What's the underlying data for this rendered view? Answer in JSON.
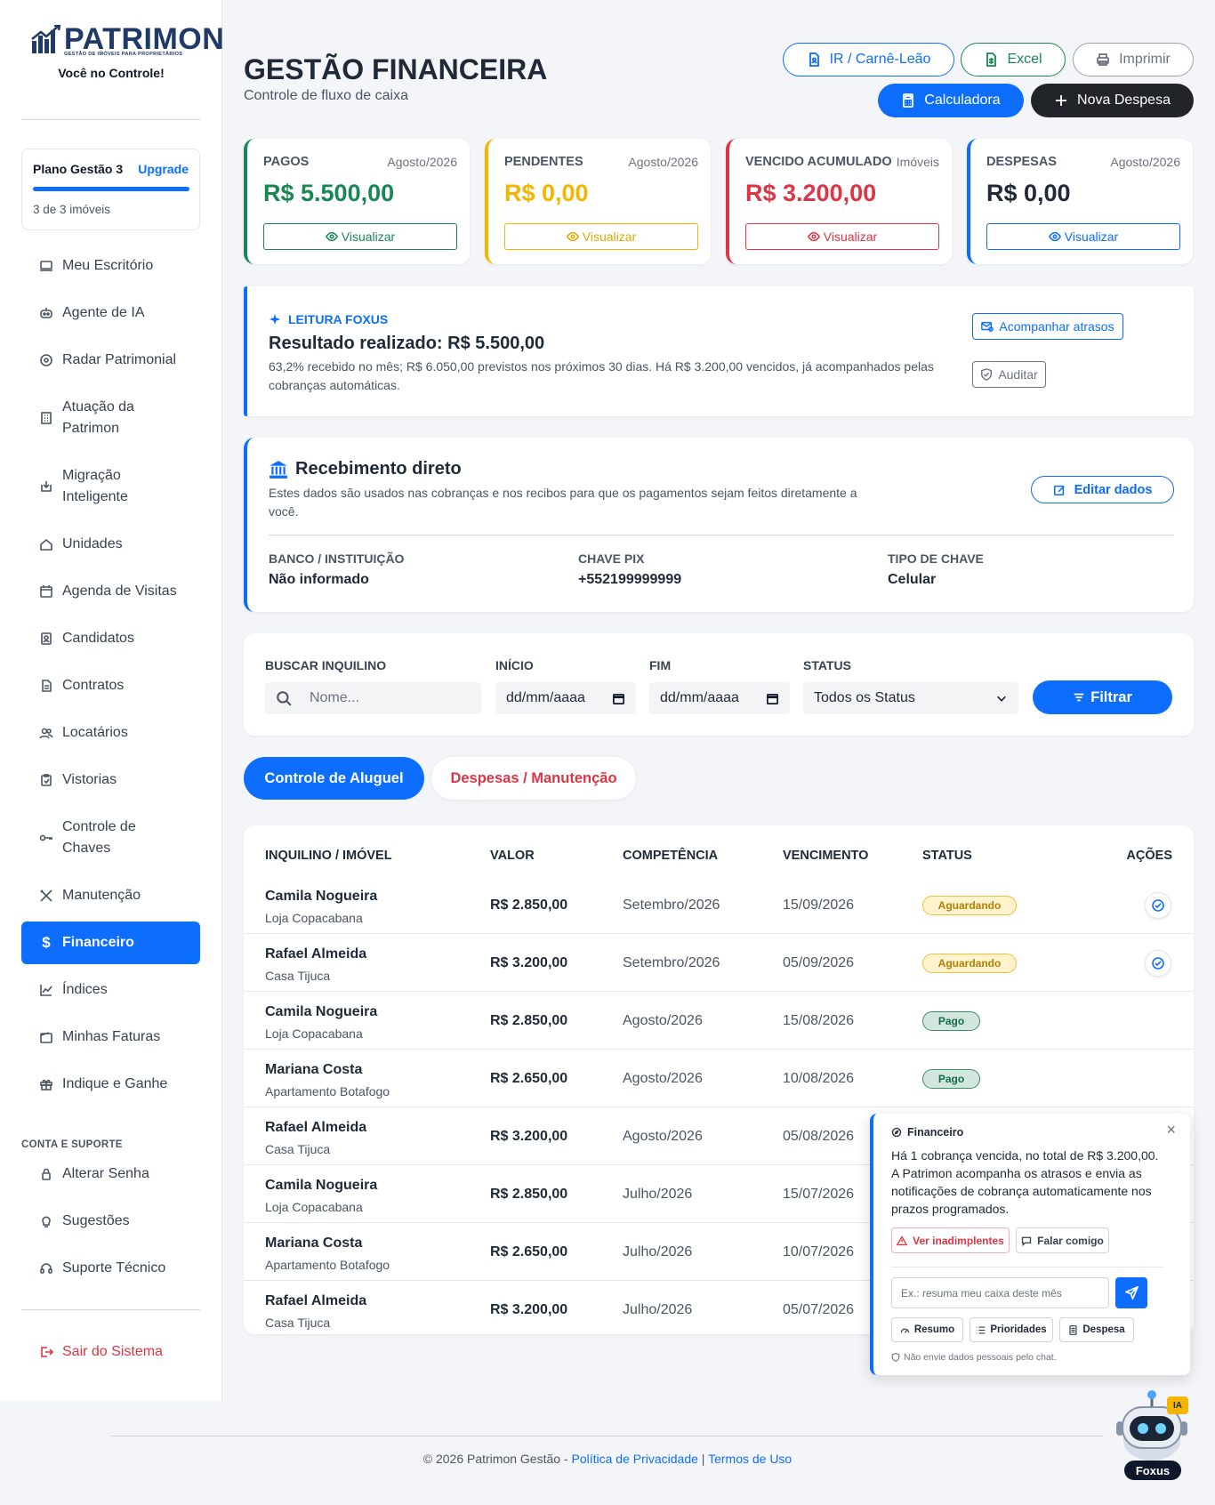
{
  "sidebar": {
    "brand": "PATRIMON",
    "brand_sub": "GESTÃO DE IMÓVEIS PARA PROPRIETÁRIOS",
    "tagline": "Você no Controle!",
    "plan": {
      "name": "Plano Gestão 3",
      "upgrade": "Upgrade",
      "count": "3 de 3 imóveis",
      "usage_fraction": 1.0
    },
    "items": [
      {
        "label": "Meu Escritório",
        "icon": "laptop-icon"
      },
      {
        "label": "Agente de IA",
        "icon": "robot-icon"
      },
      {
        "label": "Radar Patrimonial",
        "icon": "radar-icon"
      },
      {
        "label": "Atuação da Patrimon",
        "icon": "building-icon"
      },
      {
        "label": "Migração Inteligente",
        "icon": "inbox-icon"
      },
      {
        "label": "Unidades",
        "icon": "home-icon"
      },
      {
        "label": "Agenda de Visitas",
        "icon": "calendar-icon"
      },
      {
        "label": "Candidatos",
        "icon": "id-badge-icon"
      },
      {
        "label": "Contratos",
        "icon": "file-icon"
      },
      {
        "label": "Locatários",
        "icon": "people-icon"
      },
      {
        "label": "Vistorias",
        "icon": "clipboard-icon"
      },
      {
        "label": "Controle de Chaves",
        "icon": "key-icon"
      },
      {
        "label": "Manutenção",
        "icon": "tools-icon"
      },
      {
        "label": "Financeiro",
        "icon": "dollar-icon",
        "active": true
      },
      {
        "label": "Índices",
        "icon": "chart-icon"
      },
      {
        "label": "Minhas Faturas",
        "icon": "wallet-icon"
      },
      {
        "label": "Indique e Ganhe",
        "icon": "gift-icon"
      }
    ],
    "support_title": "CONTA E SUPORTE",
    "support_items": [
      {
        "label": "Alterar Senha",
        "icon": "lock-icon"
      },
      {
        "label": "Sugestões",
        "icon": "lightbulb-icon"
      },
      {
        "label": "Suporte Técnico",
        "icon": "headset-icon"
      }
    ],
    "logout": "Sair do Sistema"
  },
  "header": {
    "title": "GESTÃO FINANCEIRA",
    "subtitle": "Controle de fluxo de caixa",
    "buttons": {
      "ir": "IR / Carnê-Leão",
      "excel": "Excel",
      "print": "Imprimir",
      "calc": "Calculadora",
      "new": "Nova Despesa"
    }
  },
  "cards": [
    {
      "title": "PAGOS",
      "period": "Agosto/2026",
      "value": "R$ 5.500,00",
      "action": "Visualizar",
      "color": "#198754"
    },
    {
      "title": "PENDENTES",
      "period": "Agosto/2026",
      "value": "R$ 0,00",
      "action": "Visualizar",
      "color": "#f5b400"
    },
    {
      "title": "VENCIDO ACUMULADO",
      "period": "Imóveis",
      "value": "R$ 3.200,00",
      "action": "Visualizar",
      "color": "#dc3545"
    },
    {
      "title": "DESPESAS",
      "period": "Agosto/2026",
      "value": "R$ 0,00",
      "action": "Visualizar",
      "color": "#0d6efd"
    }
  ],
  "foxus": {
    "tag": "LEITURA FOXUS",
    "title": "Resultado realizado: R$ 5.500,00",
    "text": "63,2% recebido no mês; R$ 6.050,00 previstos nos próximos 30 dias. Há R$ 3.200,00 vencidos, já acompanhados pelas cobranças automáticas.",
    "btn_track": "Acompanhar atrasos",
    "btn_audit": "Auditar"
  },
  "direct": {
    "title": "Recebimento direto",
    "text": "Estes dados são usados nas cobranças e nos recibos para que os pagamentos sejam feitos diretamente a você.",
    "edit": "Editar dados",
    "fields": [
      {
        "k": "BANCO / INSTITUIÇÃO",
        "v": "Não informado"
      },
      {
        "k": "CHAVE PIX",
        "v": "+552199999999"
      },
      {
        "k": "TIPO DE CHAVE",
        "v": "Celular"
      }
    ]
  },
  "filters": {
    "search_label": "BUSCAR INQUILINO",
    "search_placeholder": "Nome...",
    "start_label": "INÍCIO",
    "start_value": "dd/mm/aaaa",
    "end_label": "FIM",
    "end_value": "dd/mm/aaaa",
    "status_label": "STATUS",
    "status_value": "Todos os Status",
    "filter_button": "Filtrar"
  },
  "tabs": {
    "rent": "Controle de Aluguel",
    "expenses": "Despesas / Manutenção"
  },
  "table": {
    "headers": [
      "INQUILINO / IMÓVEL",
      "VALOR",
      "COMPETÊNCIA",
      "VENCIMENTO",
      "STATUS",
      "AÇÕES"
    ],
    "rows": [
      {
        "tenant": "Camila Nogueira",
        "property": "Loja Copacabana",
        "value": "R$ 2.850,00",
        "period": "Setembro/2026",
        "due": "15/09/2026",
        "status": "Aguardando",
        "kind": "wait"
      },
      {
        "tenant": "Rafael Almeida",
        "property": "Casa Tijuca",
        "value": "R$ 3.200,00",
        "period": "Setembro/2026",
        "due": "05/09/2026",
        "status": "Aguardando",
        "kind": "wait"
      },
      {
        "tenant": "Camila Nogueira",
        "property": "Loja Copacabana",
        "value": "R$ 2.850,00",
        "period": "Agosto/2026",
        "due": "15/08/2026",
        "status": "Pago",
        "kind": "paid"
      },
      {
        "tenant": "Mariana Costa",
        "property": "Apartamento Botafogo",
        "value": "R$ 2.650,00",
        "period": "Agosto/2026",
        "due": "10/08/2026",
        "status": "Pago",
        "kind": "paid"
      },
      {
        "tenant": "Rafael Almeida",
        "property": "Casa Tijuca",
        "value": "R$ 3.200,00",
        "period": "Agosto/2026",
        "due": "05/08/2026",
        "status": "",
        "kind": ""
      },
      {
        "tenant": "Camila Nogueira",
        "property": "Loja Copacabana",
        "value": "R$ 2.850,00",
        "period": "Julho/2026",
        "due": "15/07/2026",
        "status": "",
        "kind": ""
      },
      {
        "tenant": "Mariana Costa",
        "property": "Apartamento Botafogo",
        "value": "R$ 2.650,00",
        "period": "Julho/2026",
        "due": "10/07/2026",
        "status": "",
        "kind": ""
      },
      {
        "tenant": "Rafael Almeida",
        "property": "Casa Tijuca",
        "value": "R$ 3.200,00",
        "period": "Julho/2026",
        "due": "05/07/2026",
        "status": "",
        "kind": ""
      }
    ]
  },
  "chat": {
    "title": "Financeiro",
    "message": "Há 1 cobrança vencida, no total de R$ 3.200,00. A Patrimon acompanha os atrasos e envia as notificações de cobrança automaticamente nos prazos programados.",
    "btn_overdue": "Ver inadimplentes",
    "btn_talk": "Falar comigo",
    "input_placeholder": "Ex.: resuma meu caixa deste mês",
    "quick": [
      "Resumo",
      "Prioridades",
      "Despesa"
    ],
    "note": "Não envie dados pessoais pelo chat."
  },
  "bot": {
    "name": "Foxus",
    "badge": "IA"
  },
  "footer": {
    "copyright": "© 2026 Patrimon Gestão - ",
    "privacy": "Política de Privacidade",
    "sep": " | ",
    "terms": "Termos de Uso"
  }
}
